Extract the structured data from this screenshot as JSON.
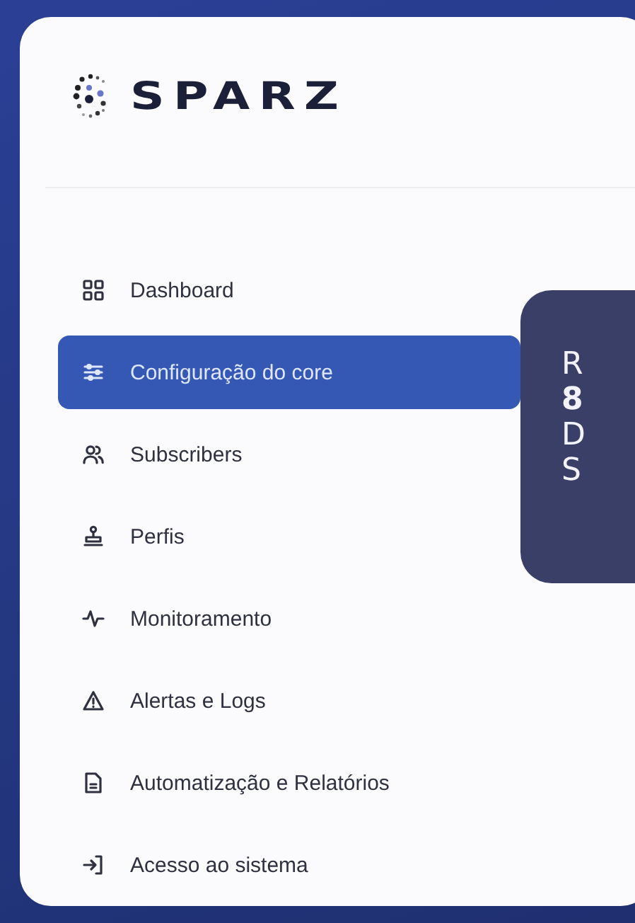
{
  "logo": {
    "text": "SPARZ"
  },
  "sidebar": {
    "items": [
      {
        "label": "Dashboard",
        "selected": false
      },
      {
        "label": "Configuração do core",
        "selected": true
      },
      {
        "label": "Subscribers",
        "selected": false
      },
      {
        "label": "Perfis",
        "selected": false
      },
      {
        "label": "Monitoramento",
        "selected": false
      },
      {
        "label": "Alertas e Logs",
        "selected": false
      },
      {
        "label": "Automatização e Relatórios",
        "selected": false
      },
      {
        "label": "Acesso ao sistema",
        "selected": false
      }
    ]
  },
  "promo_card": {
    "lines": [
      {
        "text": "R",
        "bold": false
      },
      {
        "text": "8",
        "bold": true
      },
      {
        "text": "D",
        "bold": false
      },
      {
        "text": "S",
        "bold": false
      }
    ]
  }
}
